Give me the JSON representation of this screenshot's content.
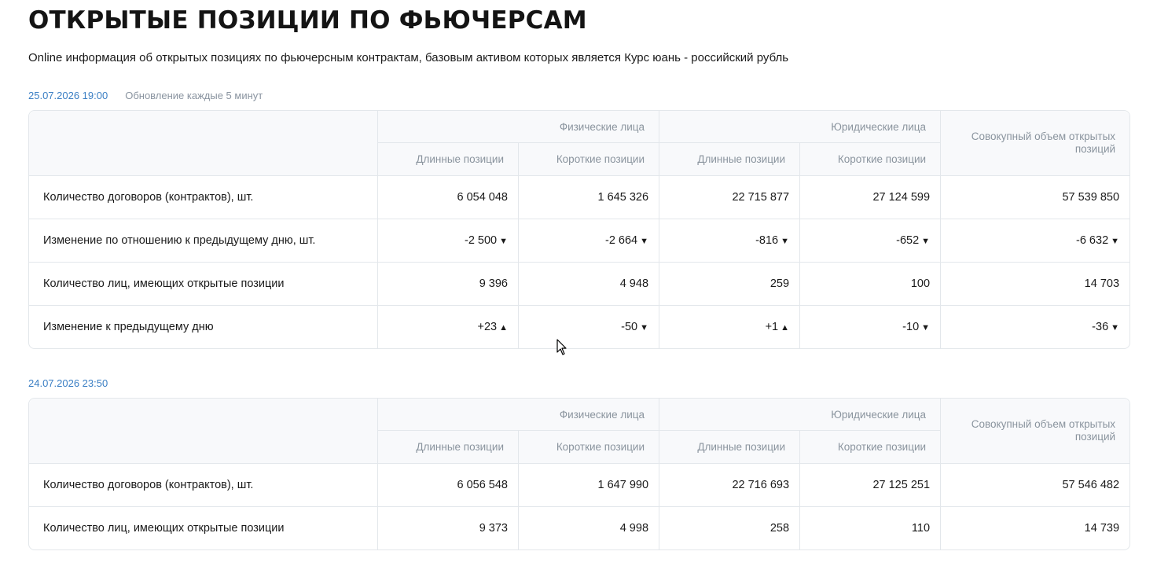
{
  "page": {
    "title": "ОТКРЫТЫЕ ПОЗИЦИИ ПО ФЬЮЧЕРСАМ",
    "subtitle": "Online информация об открытых позициях по фьючерсным контрактам, базовым активом которых является Курс юань - российский рубль"
  },
  "colors": {
    "accent": "#3b7fc4",
    "negative": "#e02020",
    "positive": "#2e9a3e",
    "header_bg": "#f8f9fb",
    "border": "#e3e7eb"
  },
  "headers": {
    "individuals": "Физические лица",
    "legal": "Юридические лица",
    "long": "Длинные позиции",
    "short": "Короткие позиции",
    "total": "Совокупный объем открытых позиций"
  },
  "tables": [
    {
      "date": "25.07.2026 19:00",
      "update_note": "Обновление каждые 5 минут",
      "rows": [
        {
          "label": "Количество договоров (контрактов), шт.",
          "values": [
            "6 054 048",
            "1 645 326",
            "22 715 877",
            "27 124 599",
            "57 539 850"
          ]
        },
        {
          "label": "Изменение по отношению к предыдущему дню, шт.",
          "values": [
            "-2 500",
            "-2 664",
            "-816",
            "-652",
            "-6 632"
          ],
          "trend": [
            "down",
            "down",
            "down",
            "down",
            "down"
          ]
        },
        {
          "label": "Количество лиц, имеющих открытые позиции",
          "values": [
            "9 396",
            "4 948",
            "259",
            "100",
            "14 703"
          ]
        },
        {
          "label": "Изменение к предыдущему дню",
          "values": [
            "+23",
            "-50",
            "+1",
            "-10",
            "-36"
          ],
          "trend": [
            "up",
            "down",
            "up",
            "down",
            "down"
          ]
        }
      ]
    },
    {
      "date": "24.07.2026 23:50",
      "rows": [
        {
          "label": "Количество договоров (контрактов), шт.",
          "values": [
            "6 056 548",
            "1 647 990",
            "22 716 693",
            "27 125 251",
            "57 546 482"
          ]
        },
        {
          "label": "Количество лиц, имеющих открытые позиции",
          "values": [
            "9 373",
            "4 998",
            "258",
            "110",
            "14 739"
          ]
        }
      ]
    }
  ]
}
